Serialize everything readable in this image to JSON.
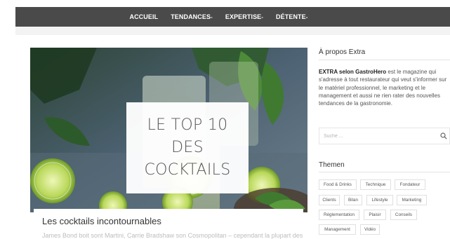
{
  "nav": {
    "items": [
      {
        "label": "ACCUEIL",
        "caret": ""
      },
      {
        "label": "TENDANCES",
        "caret": "-"
      },
      {
        "label": "EXPERTISE",
        "caret": "-"
      },
      {
        "label": "DÉTENTE",
        "caret": "-"
      }
    ]
  },
  "hero": {
    "overlay_text": "LE TOP 10\nDES\nCOCKTAILS",
    "caption_title": "Les cocktails incontournables",
    "excerpt": "James Bond boit sont Martini, Carrie Bradshaw son Cosmopolitan – cependant la plupart des"
  },
  "sidebar": {
    "about": {
      "title": "À propos Extra",
      "strong": "EXTRA selon GastroHero",
      "text": " est le magazine qui s'adresse à tout restaurateur qui veut s'informer sur le matériel professionnel, le marketing et le management et aussi ne rien rater des nouvelles tendances de la gastronomie."
    },
    "search": {
      "placeholder": "Suche ..."
    },
    "themes": {
      "title": "Themen",
      "tags": [
        "Food & Drinks",
        "Technique",
        "Fondateur",
        "Clients",
        "Bilan",
        "Lifestyle",
        "Marketing",
        "Réglementation",
        "Plaisir",
        "Conseils",
        "Management",
        "Vidéo"
      ]
    }
  },
  "colors": {
    "nav_bg": "#4a4a4a",
    "accent": "#d9534f"
  }
}
